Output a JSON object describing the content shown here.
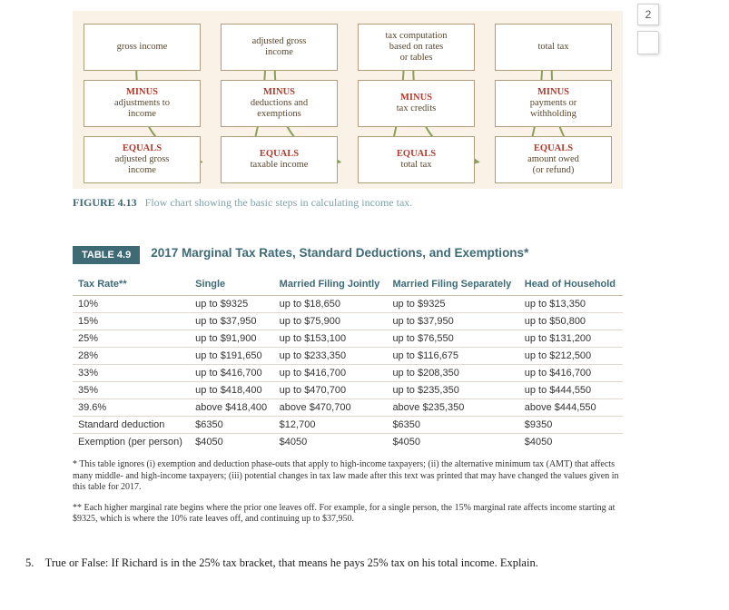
{
  "page_tab": "2",
  "flowchart": {
    "rows": [
      [
        {
          "head": "",
          "lines": [
            "gross income"
          ]
        },
        {
          "head": "",
          "lines": [
            "adjusted gross",
            "income"
          ]
        },
        {
          "head": "",
          "lines": [
            "tax computation",
            "based on rates",
            "or tables"
          ]
        },
        {
          "head": "",
          "lines": [
            "total tax"
          ]
        }
      ],
      [
        {
          "head": "MINUS",
          "lines": [
            "adjustments to",
            "income"
          ]
        },
        {
          "head": "MINUS",
          "lines": [
            "deductions and",
            "exemptions"
          ]
        },
        {
          "head": "MINUS",
          "lines": [
            "tax credits"
          ]
        },
        {
          "head": "MINUS",
          "lines": [
            "payments or",
            "withholding"
          ]
        }
      ],
      [
        {
          "head": "EQUALS",
          "lines": [
            "adjusted gross",
            "income"
          ]
        },
        {
          "head": "EQUALS",
          "lines": [
            "taxable income"
          ]
        },
        {
          "head": "EQUALS",
          "lines": [
            "total tax"
          ]
        },
        {
          "head": "EQUALS",
          "lines": [
            "amount owed",
            "(or refund)"
          ]
        }
      ]
    ]
  },
  "figure": {
    "label": "FIGURE 4.13",
    "caption": "Flow chart showing the basic steps in calculating income tax."
  },
  "table": {
    "tag": "TABLE 4.9",
    "title": "2017 Marginal Tax Rates, Standard Deductions, and Exemptions*",
    "headers": [
      "Tax Rate**",
      "Single",
      "Married Filing Jointly",
      "Married Filing Separately",
      "Head of Household"
    ],
    "rows": [
      [
        "10%",
        "up to $9325",
        "up to $18,650",
        "up to $9325",
        "up to $13,350"
      ],
      [
        "15%",
        "up to $37,950",
        "up to $75,900",
        "up to $37,950",
        "up to $50,800"
      ],
      [
        "25%",
        "up to $91,900",
        "up to $153,100",
        "up to $76,550",
        "up to $131,200"
      ],
      [
        "28%",
        "up to $191,650",
        "up to $233,350",
        "up to $116,675",
        "up to $212,500"
      ],
      [
        "33%",
        "up to $416,700",
        "up to $416,700",
        "up to $208,350",
        "up to $416,700"
      ],
      [
        "35%",
        "up to $418,400",
        "up to $470,700",
        "up to $235,350",
        "up to $444,550"
      ],
      [
        "39.6%",
        "above $418,400",
        "above $470,700",
        "above $235,350",
        "above $444,550"
      ],
      [
        "Standard deduction",
        "$6350",
        "$12,700",
        "$6350",
        "$9350"
      ],
      [
        "Exemption (per person)",
        "$4050",
        "$4050",
        "$4050",
        "$4050"
      ]
    ],
    "footnote1": "* This table ignores (i) exemption and deduction phase-outs that apply to high-income taxpayers; (ii) the alternative minimum tax (AMT) that affects many middle- and high-income taxpayers; (iii) potential changes in tax law made after this text was printed that may have changed the values given in this table for 2017.",
    "footnote2": "** Each higher marginal rate begins where the prior one leaves off. For example, for a single person, the 15% marginal rate affects income starting at $9325, which is where the 10% rate leaves off, and continuing up to $37,950."
  },
  "question": {
    "number": "5.",
    "text": "True or False:  If Richard is in the 25% tax bracket, that means he pays 25% tax on his total income.  Explain."
  }
}
